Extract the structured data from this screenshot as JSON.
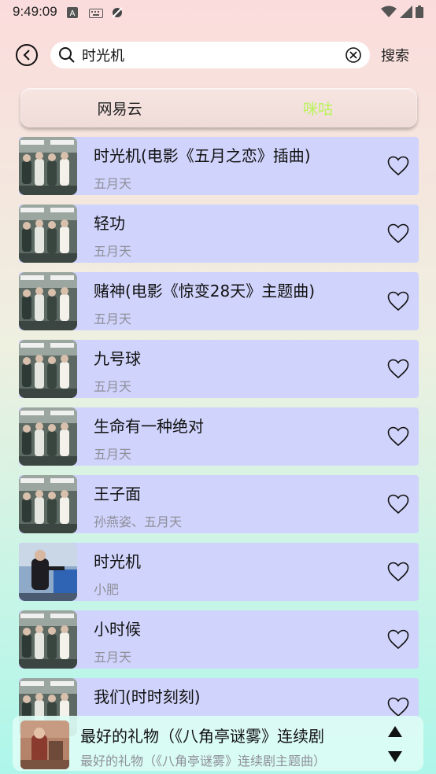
{
  "status_bar": {
    "time": "9:49:09"
  },
  "search": {
    "query": "时光机",
    "button_label": "搜索"
  },
  "tabs": [
    {
      "label": "网易云",
      "color": "#222222"
    },
    {
      "label": "咪咕",
      "color": "#b9f35a"
    }
  ],
  "songs": [
    {
      "title": "时光机(电影《五月之恋》插曲)",
      "artist": "五月天"
    },
    {
      "title": "轻功",
      "artist": "五月天"
    },
    {
      "title": "赌神(电影《惊变28天》主题曲)",
      "artist": "五月天"
    },
    {
      "title": "九号球",
      "artist": "五月天"
    },
    {
      "title": "生命有一种绝对",
      "artist": "五月天"
    },
    {
      "title": "王子面",
      "artist": "孙燕姿、五月天"
    },
    {
      "title": "时光机",
      "artist": "小肥"
    },
    {
      "title": "小时候",
      "artist": "五月天"
    },
    {
      "title": "我们(时时刻刻)",
      "artist": ""
    }
  ],
  "now_playing": {
    "title": "最好的礼物（《八角亭谜雾》连续剧",
    "subtitle": "最好的礼物（《八角亭谜雾》连续剧主题曲）"
  },
  "colors": {
    "row_background": "#d0d3fb",
    "active_tab": "#b9f35a",
    "artist_text": "#8f8f9a"
  }
}
